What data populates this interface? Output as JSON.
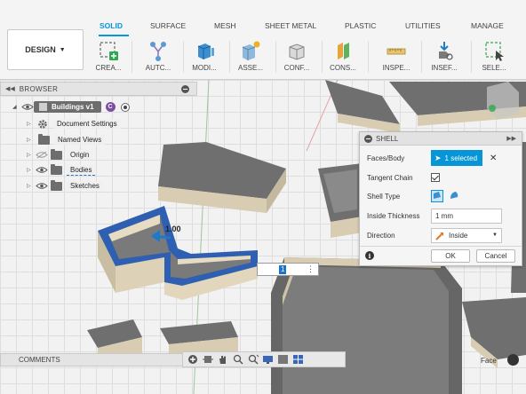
{
  "ribbon": {
    "workspace": "DESIGN",
    "tabs": [
      "SOLID",
      "SURFACE",
      "MESH",
      "SHEET METAL",
      "PLASTIC",
      "UTILITIES",
      "MANAGE"
    ],
    "active_tab": "SOLID",
    "tools": [
      "CREA...",
      "AUTC...",
      "MODI...",
      "ASSE...",
      "CONF...",
      "CONS...",
      "INSPE...",
      "INSEF...",
      "SELE..."
    ]
  },
  "browser": {
    "title": "BROWSER",
    "root": "Buildings v1",
    "root_badge": "C",
    "items": [
      "Document Settings",
      "Named Views",
      "Origin",
      "Bodies",
      "Sketches"
    ]
  },
  "shell_dialog": {
    "title": "SHELL",
    "faces_body_label": "Faces/Body",
    "faces_body_value": "1 selected",
    "tangent_chain_label": "Tangent Chain",
    "tangent_chain_checked": true,
    "shell_type_label": "Shell Type",
    "inside_thickness_label": "Inside Thickness",
    "inside_thickness_value": "1 mm",
    "direction_label": "Direction",
    "direction_value": "Inside",
    "ok_label": "OK",
    "cancel_label": "Cancel"
  },
  "viewport": {
    "dimension_label": "1.00",
    "inline_value": "1"
  },
  "bottom": {
    "comments_title": "COMMENTS",
    "selection_filter": "Face"
  },
  "colors": {
    "accent": "#0696d7",
    "selection": "#2f5fb0",
    "building_top": "#737373",
    "building_side": "#d9cdb3"
  }
}
